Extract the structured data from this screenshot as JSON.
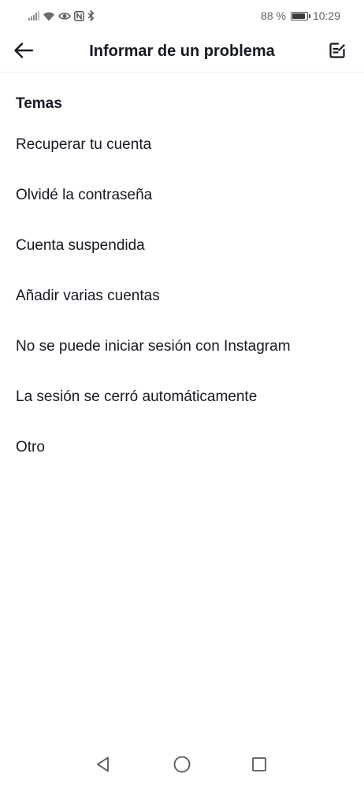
{
  "status_bar": {
    "battery_percent": "88 %",
    "battery_level": 0.88,
    "time": "10:29",
    "icons": [
      "signal-icon",
      "wifi-icon",
      "eye-icon",
      "nfc-icon",
      "bluetooth-icon",
      "battery-icon"
    ]
  },
  "header": {
    "title": "Informar de un problema",
    "back_icon": "arrow-left-icon",
    "action_icon": "edit-note-icon"
  },
  "section": {
    "title": "Temas"
  },
  "topics": [
    {
      "label": "Recuperar tu cuenta"
    },
    {
      "label": "Olvidé la contraseña"
    },
    {
      "label": "Cuenta suspendida"
    },
    {
      "label": "Añadir varias cuentas"
    },
    {
      "label": "No se puede iniciar sesión con Instagram"
    },
    {
      "label": "La sesión se cerró automáticamente"
    },
    {
      "label": "Otro"
    }
  ],
  "nav_bar": {
    "icons": [
      "nav-back-icon",
      "nav-home-icon",
      "nav-recent-icon"
    ]
  },
  "colors": {
    "text": "#161823",
    "divider": "#ebebeb",
    "status_text": "#5f5f5f"
  }
}
